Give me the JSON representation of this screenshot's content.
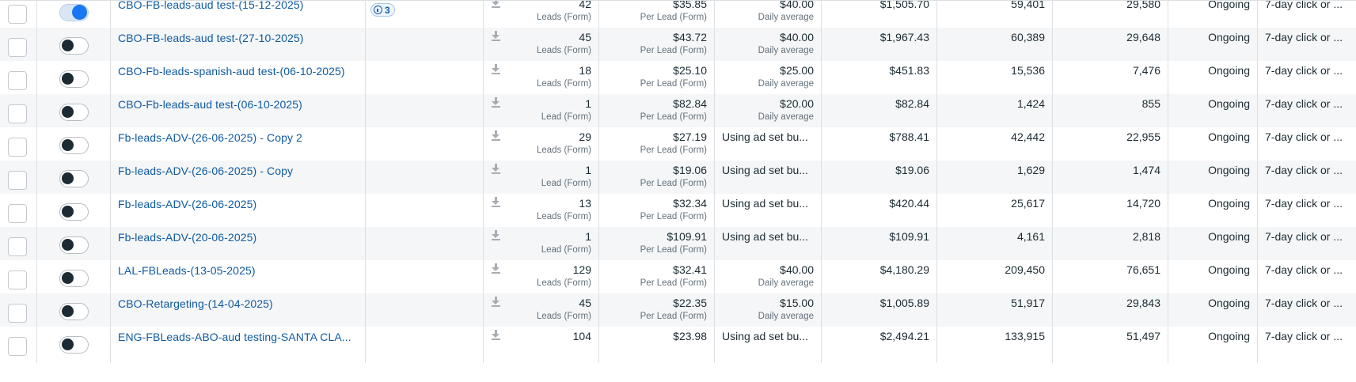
{
  "rows": [
    {
      "on": true,
      "name": "CBO-FB-leads-aud test-(15-12-2025)",
      "tag": "3",
      "results": "42",
      "results_sub": "Leads (Form)",
      "cpr": "$35.85",
      "cpr_sub": "Per Lead (Form)",
      "budget": "$40.00",
      "budget_sub": "Daily average",
      "spent": "$1,505.70",
      "reach": "59,401",
      "impressions": "29,580",
      "ends": "Ongoing",
      "attribution": "7-day click or ..."
    },
    {
      "on": false,
      "name": "CBO-FB-leads-aud test-(27-10-2025)",
      "results": "45",
      "results_sub": "Leads (Form)",
      "cpr": "$43.72",
      "cpr_sub": "Per Lead (Form)",
      "budget": "$40.00",
      "budget_sub": "Daily average",
      "spent": "$1,967.43",
      "reach": "60,389",
      "impressions": "29,648",
      "ends": "Ongoing",
      "attribution": "7-day click or ..."
    },
    {
      "on": false,
      "name": "CBO-Fb-leads-spanish-aud test-(06-10-2025)",
      "results": "18",
      "results_sub": "Leads (Form)",
      "cpr": "$25.10",
      "cpr_sub": "Per Lead (Form)",
      "budget": "$25.00",
      "budget_sub": "Daily average",
      "spent": "$451.83",
      "reach": "15,536",
      "impressions": "7,476",
      "ends": "Ongoing",
      "attribution": "7-day click or ..."
    },
    {
      "on": false,
      "name": "CBO-Fb-leads-aud test-(06-10-2025)",
      "results": "1",
      "results_sub": "Lead (Form)",
      "cpr": "$82.84",
      "cpr_sub": "Per Lead (Form)",
      "budget": "$20.00",
      "budget_sub": "Daily average",
      "spent": "$82.84",
      "reach": "1,424",
      "impressions": "855",
      "ends": "Ongoing",
      "attribution": "7-day click or ..."
    },
    {
      "on": false,
      "name": "Fb-leads-ADV-(26-06-2025) - Copy 2",
      "results": "29",
      "results_sub": "Leads (Form)",
      "cpr": "$27.19",
      "cpr_sub": "Per Lead (Form)",
      "budget": "Using ad set bu...",
      "budget_left": true,
      "spent": "$788.41",
      "reach": "42,442",
      "impressions": "22,955",
      "ends": "Ongoing",
      "attribution": "7-day click or ..."
    },
    {
      "on": false,
      "name": "Fb-leads-ADV-(26-06-2025) - Copy",
      "results": "1",
      "results_sub": "Lead (Form)",
      "cpr": "$19.06",
      "cpr_sub": "Per Lead (Form)",
      "budget": "Using ad set bu...",
      "budget_left": true,
      "spent": "$19.06",
      "reach": "1,629",
      "impressions": "1,474",
      "ends": "Ongoing",
      "attribution": "7-day click or ..."
    },
    {
      "on": false,
      "name": "Fb-leads-ADV-(26-06-2025)",
      "results": "13",
      "results_sub": "Leads (Form)",
      "cpr": "$32.34",
      "cpr_sub": "Per Lead (Form)",
      "budget": "Using ad set bu...",
      "budget_left": true,
      "spent": "$420.44",
      "reach": "25,617",
      "impressions": "14,720",
      "ends": "Ongoing",
      "attribution": "7-day click or ..."
    },
    {
      "on": false,
      "name": "Fb-leads-ADV-(20-06-2025)",
      "results": "1",
      "results_sub": "Lead (Form)",
      "cpr": "$109.91",
      "cpr_sub": "Per Lead (Form)",
      "budget": "Using ad set bu...",
      "budget_left": true,
      "spent": "$109.91",
      "reach": "4,161",
      "impressions": "2,818",
      "ends": "Ongoing",
      "attribution": "7-day click or ..."
    },
    {
      "on": false,
      "name": "LAL-FBLeads-(13-05-2025)",
      "results": "129",
      "results_sub": "Leads (Form)",
      "cpr": "$32.41",
      "cpr_sub": "Per Lead (Form)",
      "budget": "$40.00",
      "budget_sub": "Daily average",
      "spent": "$4,180.29",
      "reach": "209,450",
      "impressions": "76,651",
      "ends": "Ongoing",
      "attribution": "7-day click or ..."
    },
    {
      "on": false,
      "name": "CBO-Retargeting-(14-04-2025)",
      "results": "45",
      "results_sub": "Leads (Form)",
      "cpr": "$22.35",
      "cpr_sub": "Per Lead (Form)",
      "budget": "$15.00",
      "budget_sub": "Daily average",
      "spent": "$1,005.89",
      "reach": "51,917",
      "impressions": "29,843",
      "ends": "Ongoing",
      "attribution": "7-day click or ..."
    },
    {
      "on": false,
      "name": "ENG-FBLeads-ABO-aud testing-SANTA CLA...",
      "results": "104",
      "cpr": "$23.98",
      "budget": "Using ad set bu...",
      "budget_left": true,
      "spent": "$2,494.21",
      "reach": "133,915",
      "impressions": "51,497",
      "ends": "Ongoing",
      "attribution": "7-day click or ..."
    }
  ]
}
